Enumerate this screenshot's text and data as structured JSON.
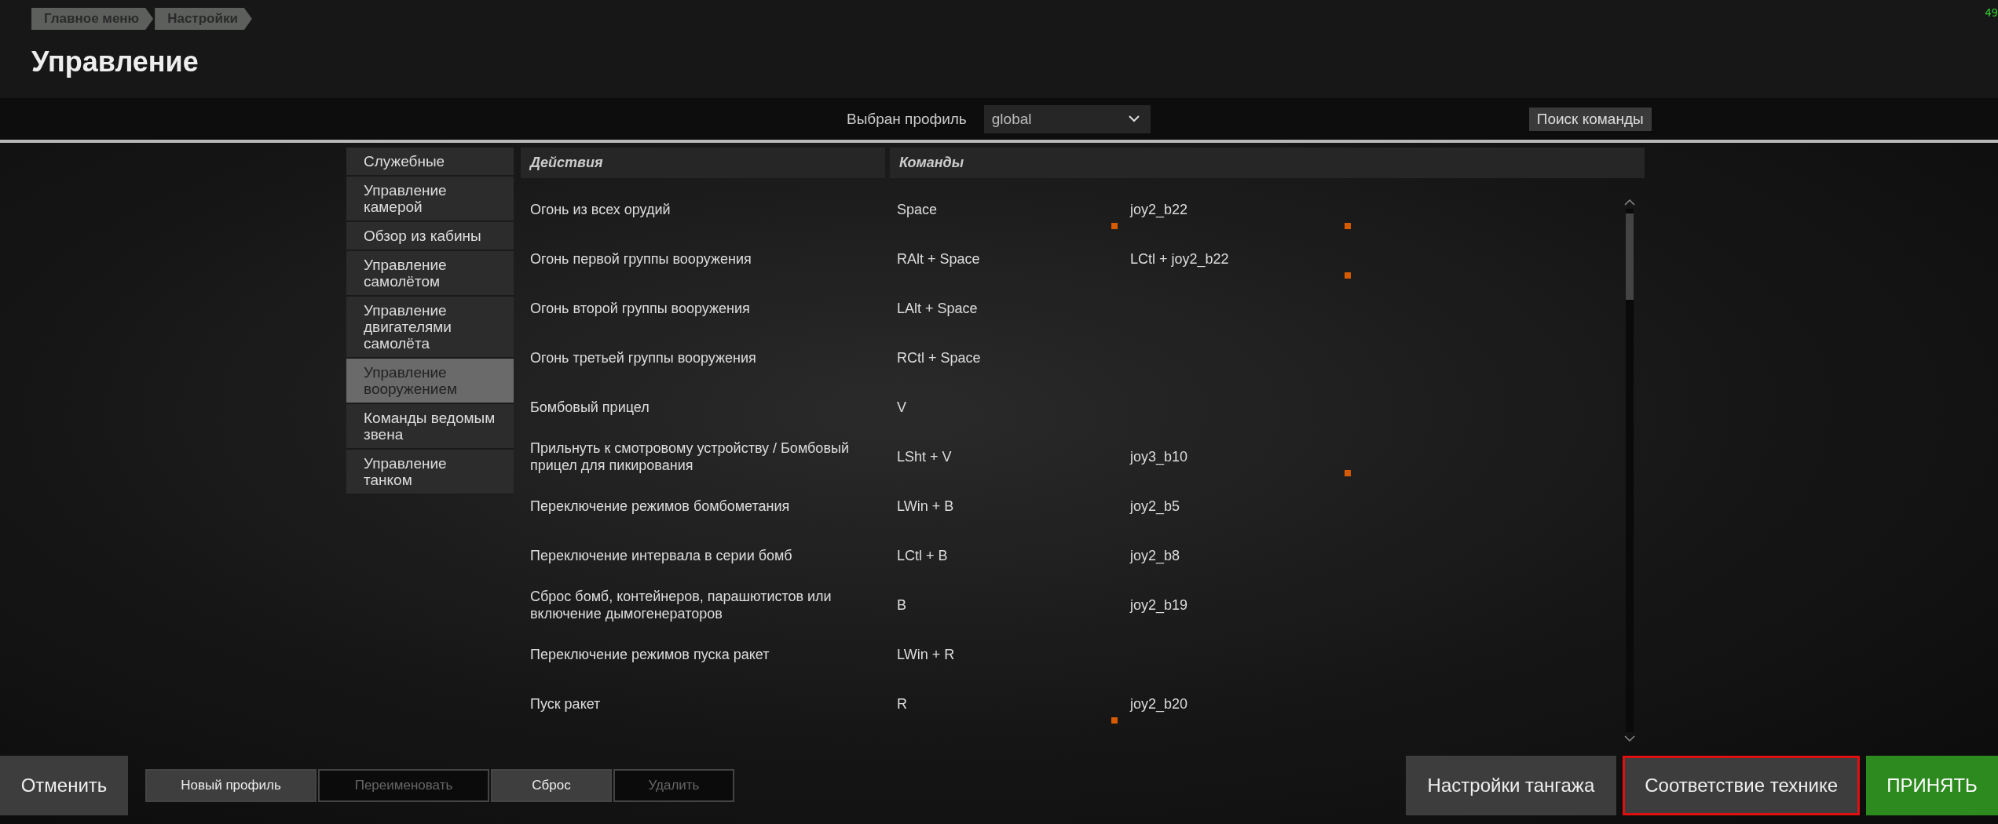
{
  "breadcrumbs": [
    "Главное меню",
    "Настройки"
  ],
  "title": "Управление",
  "fps": "49",
  "profile": {
    "label": "Выбран профиль",
    "value": "global"
  },
  "search_button": "Поиск команды",
  "sidebar": {
    "items": [
      {
        "label": "Служебные",
        "selected": false
      },
      {
        "label": "Управление камерой",
        "selected": false
      },
      {
        "label": "Обзор из кабины",
        "selected": false
      },
      {
        "label": "Управление самолётом",
        "selected": false
      },
      {
        "label": "Управление двигателями самолёта",
        "selected": false
      },
      {
        "label": "Управление вооружением",
        "selected": true
      },
      {
        "label": "Команды ведомым звена",
        "selected": false
      },
      {
        "label": "Управление танком",
        "selected": false
      }
    ]
  },
  "table": {
    "columns": [
      "Действия",
      "Команды"
    ],
    "rows": [
      {
        "action": "Огонь из всех орудий",
        "bindings": [
          {
            "text": "Space",
            "marked": true
          },
          {
            "text": "joy2_b22",
            "marked": true
          }
        ]
      },
      {
        "action": "Огонь первой группы вооружения",
        "bindings": [
          {
            "text": "RAlt + Space",
            "marked": false
          },
          {
            "text": "LCtl + joy2_b22",
            "marked": true
          }
        ]
      },
      {
        "action": "Огонь второй группы вооружения",
        "bindings": [
          {
            "text": "LAlt + Space",
            "marked": false
          }
        ]
      },
      {
        "action": "Огонь третьей группы вооружения",
        "bindings": [
          {
            "text": "RCtl + Space",
            "marked": false
          }
        ]
      },
      {
        "action": "Бомбовый прицел",
        "bindings": [
          {
            "text": "V",
            "marked": false
          }
        ]
      },
      {
        "action": "Прильнуть к смотровому устройству / Бомбовый прицел для пикирования",
        "bindings": [
          {
            "text": "LSht + V",
            "marked": false
          },
          {
            "text": "joy3_b10",
            "marked": true
          }
        ]
      },
      {
        "action": "Переключение режимов бомбометания",
        "bindings": [
          {
            "text": "LWin + B",
            "marked": false
          },
          {
            "text": "joy2_b5",
            "marked": false
          }
        ]
      },
      {
        "action": "Переключение интервала в серии бомб",
        "bindings": [
          {
            "text": "LCtl + B",
            "marked": false
          },
          {
            "text": "joy2_b8",
            "marked": false
          }
        ]
      },
      {
        "action": "Сброс бомб, контейнеров, парашютистов или включение дымогенераторов",
        "bindings": [
          {
            "text": "B",
            "marked": false
          },
          {
            "text": "joy2_b19",
            "marked": false
          }
        ]
      },
      {
        "action": "Переключение режимов пуска ракет",
        "bindings": [
          {
            "text": "LWin + R",
            "marked": false
          }
        ]
      },
      {
        "action": "Пуск ракет",
        "bindings": [
          {
            "text": "R",
            "marked": true
          },
          {
            "text": "joy2_b20",
            "marked": false
          }
        ]
      }
    ]
  },
  "footer": {
    "cancel": "Отменить",
    "profile_buttons": [
      {
        "label": "Новый профиль",
        "disabled": false
      },
      {
        "label": "Переименовать",
        "disabled": true
      },
      {
        "label": "Сброс",
        "disabled": false
      },
      {
        "label": "Удалить",
        "disabled": true
      }
    ],
    "right_buttons": [
      {
        "label": "Настройки тангажа",
        "kind": "normal",
        "highlighted": false
      },
      {
        "label": "Соответствие технике",
        "kind": "normal",
        "highlighted": true
      },
      {
        "label": "ПРИНЯТЬ",
        "kind": "accept",
        "highlighted": false
      }
    ]
  }
}
